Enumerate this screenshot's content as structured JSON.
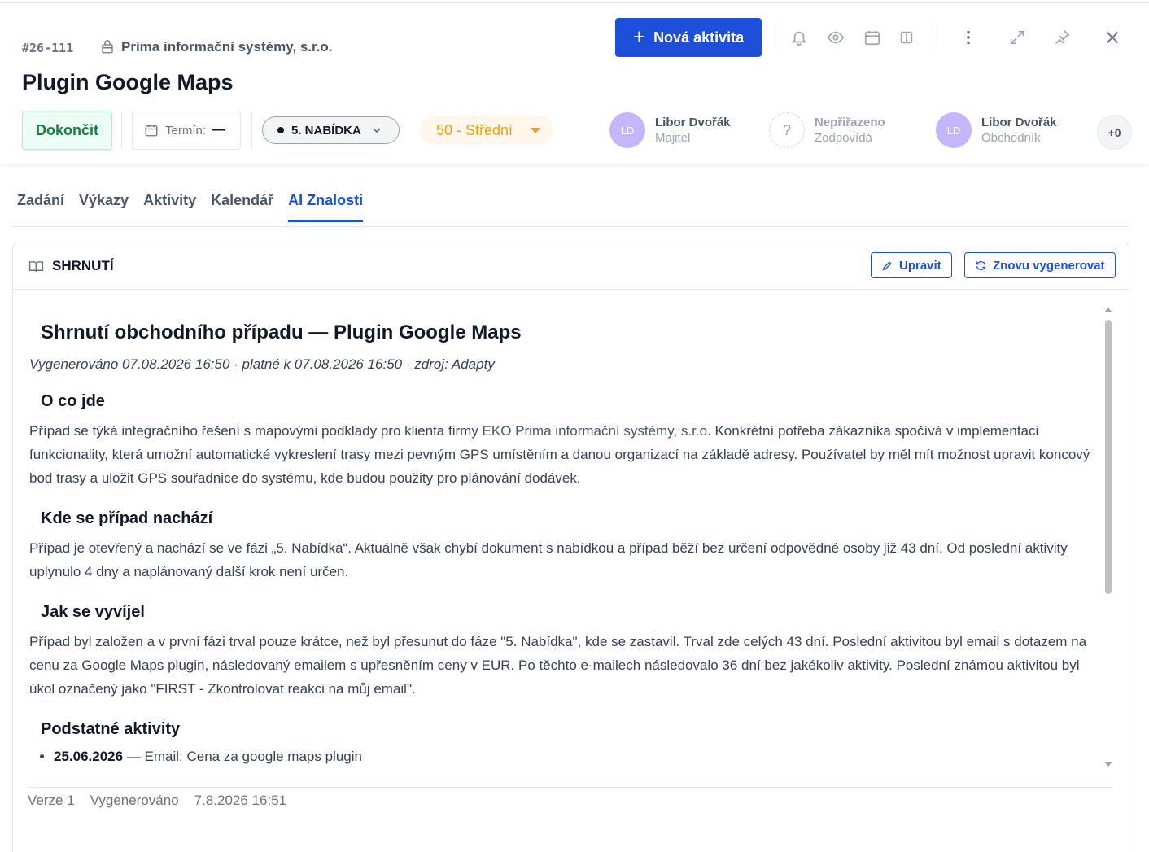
{
  "header": {
    "case_id": "#26-111",
    "company": "Prima informační systémy, s.r.o.",
    "title": "Plugin Google Maps",
    "new_activity_label": "Nová aktivita",
    "finish_label": "Dokončit",
    "term_label": "Termín:",
    "term_value": "—",
    "phase_label": "5. NABÍDKA",
    "priority_label": "50 - Střední",
    "people": [
      {
        "initials": "LD",
        "name": "Libor Dvořák",
        "role": "Majitel"
      },
      {
        "initials": "?",
        "name": "Nepřiřazeno",
        "role": "Zodpovídá"
      },
      {
        "initials": "LD",
        "name": "Libor Dvořák",
        "role": "Obchodník"
      }
    ],
    "more_count": "+0"
  },
  "tabs": [
    "Zadání",
    "Výkazy",
    "Aktivity",
    "Kalendář",
    "AI Znalosti"
  ],
  "panel": {
    "title": "SHRNUTÍ",
    "edit_label": "Upravit",
    "regenerate_label": "Znovu vygenerovat"
  },
  "summary": {
    "heading": "Shrnutí obchodního případu — Plugin Google Maps",
    "meta": "Vygenerováno 07.08.2026 16:50 · platné k 07.08.2026 16:50 · zdroj: Adapty",
    "s1_title": "O co jde",
    "s1_text_a": "Případ se týká integračního řešení s mapovými podklady pro klienta firmy ",
    "s1_company": "EKO Prima informační systémy, s.r.o.",
    "s1_text_b": " Konkrétní potřeba zákazníka spočívá v implementaci funkcionality, která umožní automatické vykreslení trasy mezi pevným GPS umístěním a danou organizací na základě adresy. Používatel by měl mít možnost upravit koncový bod trasy a uložit GPS souřadnice do systému, kde budou použity pro plánování dodávek.",
    "s2_title": "Kde se případ nachází",
    "s2_text": "Případ je otevřený a nachází se ve fázi „5. Nabídka“. Aktuálně však chybí dokument s nabídkou a případ běží bez určení odpovědné osoby již 43 dní. Od poslední aktivity uplynulo 4 dny a naplánovaný další krok není určen.",
    "s3_title": "Jak se vyvíjel",
    "s3_text": "Případ byl založen a v první fázi trval pouze krátce, než byl přesunut do fáze \"5. Nabídka\", kde se zastavil. Trval zde celých 43 dní. Poslední aktivitou byl email s dotazem na cenu za Google Maps plugin, následovaný emailem s upřesněním ceny v EUR. Po těchto e-mailech následovalo 36 dní bez jakékoliv aktivity. Poslední známou aktivitou byl úkol označený jako \"FIRST - Zkontrolovat reakci na můj email\".",
    "s4_title": "Podstatné aktivity",
    "s4_items": [
      {
        "date": "25.06.2026",
        "text": " — Email: Cena za google maps plugin"
      }
    ]
  },
  "footer": {
    "version": "Verze 1",
    "generated_label": "Vygenerováno",
    "generated_value": "7.8.2026 16:51"
  },
  "colors": {
    "accent": "#1d4fd8",
    "finish_green": "#15803d",
    "priority_orange": "#f59e0b",
    "avatar_purple": "#c4b5fd"
  }
}
